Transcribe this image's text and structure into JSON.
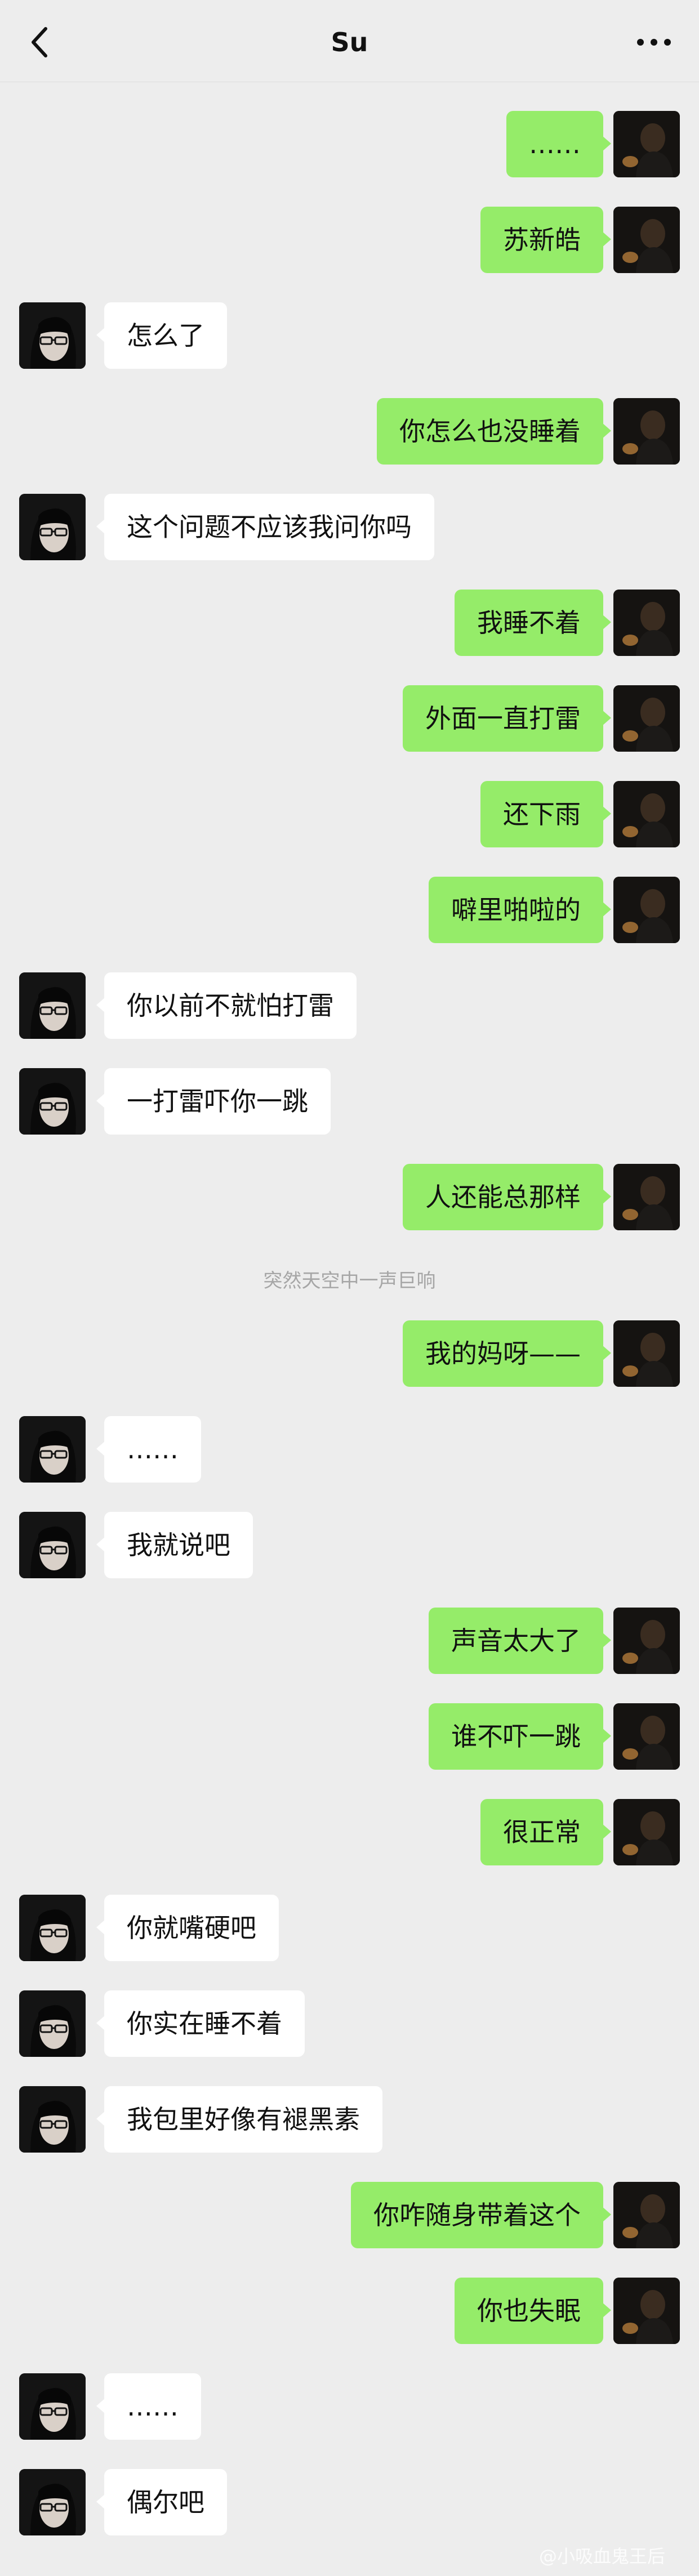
{
  "header": {
    "title": "Su",
    "back_icon": "chevron-left-icon",
    "more_icon": "more-dots-icon"
  },
  "messages": [
    {
      "from": "me",
      "text": "……"
    },
    {
      "from": "me",
      "text": "苏新皓"
    },
    {
      "from": "other",
      "text": "怎么了"
    },
    {
      "from": "me",
      "text": "你怎么也没睡着"
    },
    {
      "from": "other",
      "text": "这个问题不应该我问你吗"
    },
    {
      "from": "me",
      "text": "我睡不着"
    },
    {
      "from": "me",
      "text": "外面一直打雷"
    },
    {
      "from": "me",
      "text": "还下雨"
    },
    {
      "from": "me",
      "text": "噼里啪啦的"
    },
    {
      "from": "other",
      "text": "你以前不就怕打雷"
    },
    {
      "from": "other",
      "text": "一打雷吓你一跳"
    },
    {
      "from": "me",
      "text": "人还能总那样"
    },
    {
      "from": "system",
      "text": "突然天空中一声巨响"
    },
    {
      "from": "me",
      "text": "我的妈呀——"
    },
    {
      "from": "other",
      "text": "……"
    },
    {
      "from": "other",
      "text": "我就说吧"
    },
    {
      "from": "me",
      "text": "声音太大了"
    },
    {
      "from": "me",
      "text": "谁不吓一跳"
    },
    {
      "from": "me",
      "text": "很正常"
    },
    {
      "from": "other",
      "text": "你就嘴硬吧"
    },
    {
      "from": "other",
      "text": "你实在睡不着"
    },
    {
      "from": "other",
      "text": "我包里好像有褪黑素"
    },
    {
      "from": "me",
      "text": "你咋随身带着这个"
    },
    {
      "from": "me",
      "text": "你也失眠"
    },
    {
      "from": "other",
      "text": "……"
    },
    {
      "from": "other",
      "text": "偶尔吧"
    }
  ],
  "watermark": "@小吸血鬼王后",
  "colors": {
    "background": "#ededed",
    "my_bubble": "#95ec69",
    "other_bubble": "#ffffff"
  }
}
